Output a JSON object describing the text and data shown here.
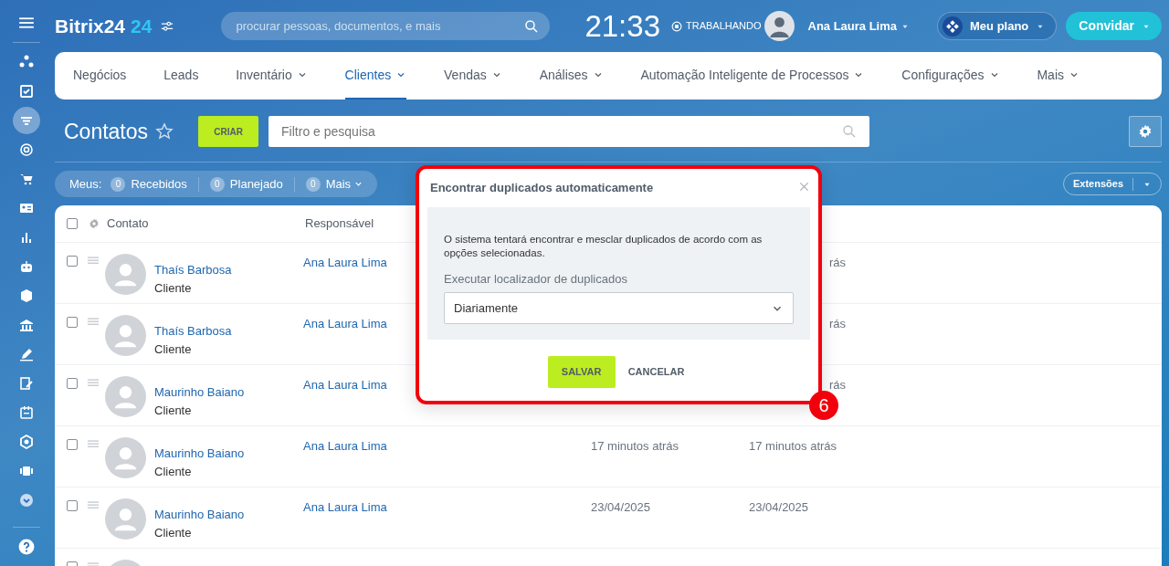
{
  "header": {
    "logo": "Bitrix24",
    "logo_suffix": "24",
    "search_placeholder": "procurar pessoas, documentos, e mais",
    "clock": "21:33",
    "work_status": "TRABALHANDO",
    "user": "Ana Laura Lima",
    "plan_button": "Meu plano",
    "invite_button": "Convidar"
  },
  "sidebar": {
    "items": [
      {
        "selected": false
      },
      {
        "selected": false
      },
      {
        "selected": true
      },
      {
        "selected": false
      },
      {
        "selected": false
      },
      {
        "selected": false
      },
      {
        "selected": false
      },
      {
        "selected": false
      },
      {
        "selected": false
      },
      {
        "selected": false
      },
      {
        "selected": false
      },
      {
        "selected": false
      },
      {
        "selected": false
      },
      {
        "selected": false
      },
      {
        "selected": false
      },
      {
        "selected": false
      }
    ]
  },
  "nav": {
    "items": [
      {
        "label": "Negócios",
        "dropdown": false,
        "selected": false
      },
      {
        "label": "Leads",
        "dropdown": false,
        "selected": false
      },
      {
        "label": "Inventário",
        "dropdown": true,
        "selected": false
      },
      {
        "label": "Clientes",
        "dropdown": true,
        "selected": true
      },
      {
        "label": "Vendas",
        "dropdown": true,
        "selected": false
      },
      {
        "label": "Análises",
        "dropdown": true,
        "selected": false
      },
      {
        "label": "Automação Inteligente de Processos",
        "dropdown": true,
        "selected": false
      },
      {
        "label": "Configurações",
        "dropdown": true,
        "selected": false
      },
      {
        "label": "Mais",
        "dropdown": true,
        "selected": false
      }
    ]
  },
  "page": {
    "title": "Contatos",
    "create_button": "CRIAR",
    "filter_placeholder": "Filtro e pesquisa",
    "extensions_button": "Extensões"
  },
  "counters": {
    "label": "Meus:",
    "items": [
      {
        "count": "0",
        "label": "Recebidos",
        "dropdown": false
      },
      {
        "count": "0",
        "label": "Planejado",
        "dropdown": false
      },
      {
        "count": "0",
        "label": "Mais",
        "dropdown": true
      }
    ]
  },
  "table": {
    "all_checked": false,
    "columns": [
      "Contato",
      "Responsável"
    ],
    "rows": [
      {
        "kind": "contact",
        "checked": false,
        "name": "Thaís Barbosa",
        "type": "Cliente",
        "responsible": "Ana Laura Lima",
        "column_4_tail": "rás"
      },
      {
        "kind": "contact",
        "checked": false,
        "name": "Thaís Barbosa",
        "type": "Cliente",
        "responsible": "Ana Laura Lima",
        "column_4_tail": "rás"
      },
      {
        "kind": "contact",
        "checked": false,
        "name": "Maurinho Baiano",
        "type": "Cliente",
        "responsible": "Ana Laura Lima",
        "column_4_tail": "rás"
      },
      {
        "kind": "contact",
        "checked": false,
        "name": "Maurinho Baiano",
        "type": "Cliente",
        "responsible": "Ana Laura Lima",
        "column_3": "17 minutos atrás",
        "column_4": "17 minutos atrás"
      },
      {
        "kind": "contact",
        "checked": false,
        "name": "Maurinho Baiano",
        "type": "Cliente",
        "responsible": "Ana Laura Lima",
        "column_3": "23/04/2025",
        "column_4": "23/04/2025"
      },
      {
        "kind": "cut",
        "checked": false
      }
    ]
  },
  "dialog": {
    "title": "Encontrar duplicados automaticamente",
    "text": "O sistema tentará encontrar e mesclar duplicados de acordo com as opções selecionadas.",
    "field_label": "Executar localizador de duplicados",
    "select_value": "Diariamente",
    "save_button": "SALVAR",
    "cancel_button": "CANCELAR",
    "callout": "6"
  }
}
